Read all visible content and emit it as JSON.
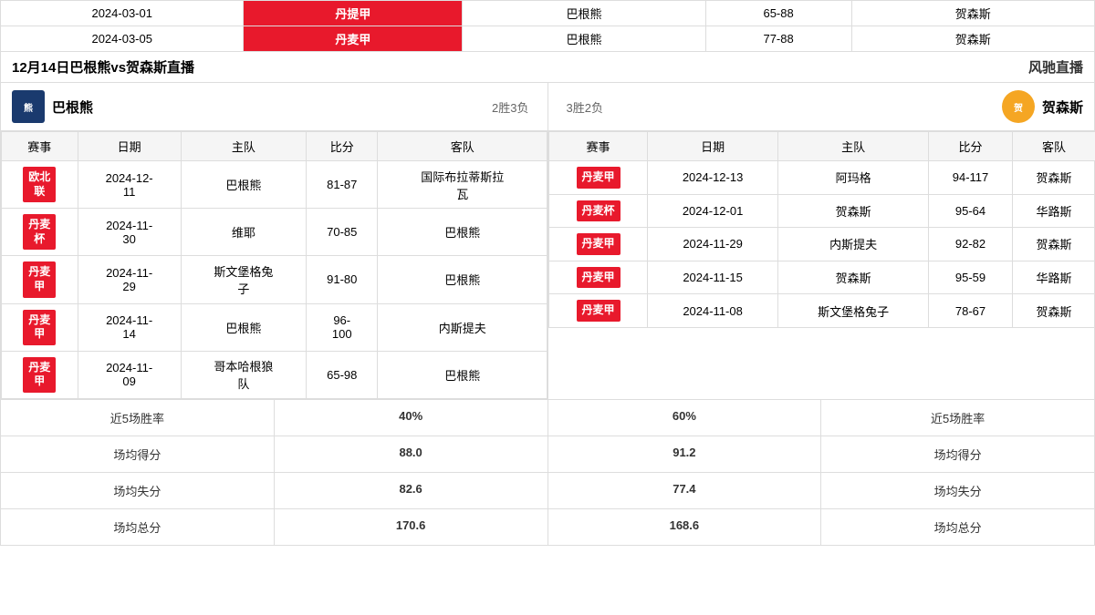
{
  "top_rows": [
    {
      "date": "2024-03-01",
      "league": "丹提甲",
      "league_color": "red",
      "home": "巴根熊",
      "score": "65-88",
      "away": "贺森斯"
    },
    {
      "date": "2024-03-05",
      "league": "丹麦甲",
      "league_color": "red",
      "home": "巴根熊",
      "score": "77-88",
      "away": "贺森斯"
    }
  ],
  "header": {
    "title": "12月14日巴根熊vs贺森斯直播",
    "brand": "风驰直播"
  },
  "team_left": {
    "name": "巴根熊",
    "record": "2胜3负"
  },
  "team_right": {
    "name": "贺森斯",
    "record": "3胜2负"
  },
  "column_headers_left": [
    "赛事",
    "日期",
    "主队",
    "比分",
    "客队"
  ],
  "column_headers_right": [
    "赛事",
    "日期",
    "主队",
    "比分",
    "客队"
  ],
  "left_records": [
    {
      "league": "欧北联",
      "date": "2024-12-11",
      "home": "巴根熊",
      "score": "81-87",
      "away": "国际布拉蒂斯拉瓦"
    },
    {
      "league": "丹麦杯",
      "date": "2024-11-30",
      "home": "维耶",
      "score": "70-85",
      "away": "巴根熊"
    },
    {
      "league": "丹麦甲",
      "date": "2024-11-29",
      "home": "斯文堡格兔子",
      "score": "91-80",
      "away": "巴根熊"
    },
    {
      "league": "丹麦甲",
      "date": "2024-11-14",
      "home": "巴根熊",
      "score": "96-100",
      "away": "内斯提夫"
    },
    {
      "league": "丹麦甲",
      "date": "2024-11-09",
      "home": "哥本哈根狼队",
      "score": "65-98",
      "away": "巴根熊"
    }
  ],
  "right_records": [
    {
      "league": "丹麦甲",
      "date": "2024-12-13",
      "home": "阿玛格",
      "score": "94-117",
      "away": "贺森斯"
    },
    {
      "league": "丹麦杯",
      "date": "2024-12-01",
      "home": "贺森斯",
      "score": "95-64",
      "away": "华路斯"
    },
    {
      "league": "丹麦甲",
      "date": "2024-11-29",
      "home": "内斯提夫",
      "score": "92-82",
      "away": "贺森斯"
    },
    {
      "league": "丹麦甲",
      "date": "2024-11-15",
      "home": "贺森斯",
      "score": "95-59",
      "away": "华路斯"
    },
    {
      "league": "丹麦甲",
      "date": "2024-11-08",
      "home": "斯文堡格兔子",
      "score": "78-67",
      "away": "贺森斯"
    }
  ],
  "stats": [
    {
      "label": "近5场胜率",
      "left_value": "40%",
      "right_value": "60%",
      "right_label": "近5场胜率"
    },
    {
      "label": "场均得分",
      "left_value": "88.0",
      "right_value": "91.2",
      "right_label": "场均得分"
    },
    {
      "label": "场均失分",
      "left_value": "82.6",
      "right_value": "77.4",
      "right_label": "场均失分"
    },
    {
      "label": "场均总分",
      "left_value": "170.6",
      "right_value": "168.6",
      "right_label": "场均总分"
    }
  ]
}
